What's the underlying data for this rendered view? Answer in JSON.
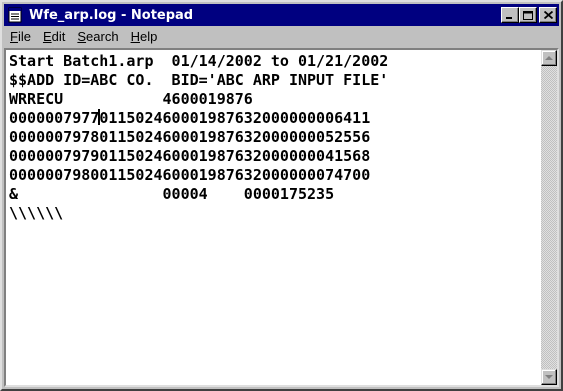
{
  "window": {
    "title": "Wfe_arp.log - Notepad",
    "icon": "notepad-icon"
  },
  "title_buttons": {
    "minimize": "minimize-icon",
    "maximize": "maximize-icon",
    "close": "close-icon"
  },
  "menu": {
    "items": [
      {
        "label": "File",
        "accel": "F",
        "rest": "ile"
      },
      {
        "label": "Edit",
        "accel": "E",
        "rest": "dit"
      },
      {
        "label": "Search",
        "accel": "S",
        "rest": "earch"
      },
      {
        "label": "Help",
        "accel": "H",
        "rest": "elp"
      }
    ]
  },
  "document": {
    "lines": [
      "Start Batch1.arp  01/14/2002 to 01/21/2002",
      "$$ADD ID=ABC CO.  BID='ABC ARP INPUT FILE'",
      "WRRECU           4600019876",
      "0000007977",
      "0000007978011502460001987632000000052556",
      "0000007979011502460001987632000000041568",
      "0000007980011502460001987632000000074700",
      "&                00004    0000175235",
      "\\\\\\\\\\\\"
    ],
    "caret_line_after": "011502460001987632000000006411"
  },
  "colors": {
    "titlebar": "#000080",
    "chrome": "#c0c0c0",
    "text": "#000000",
    "background": "#ffffff"
  }
}
